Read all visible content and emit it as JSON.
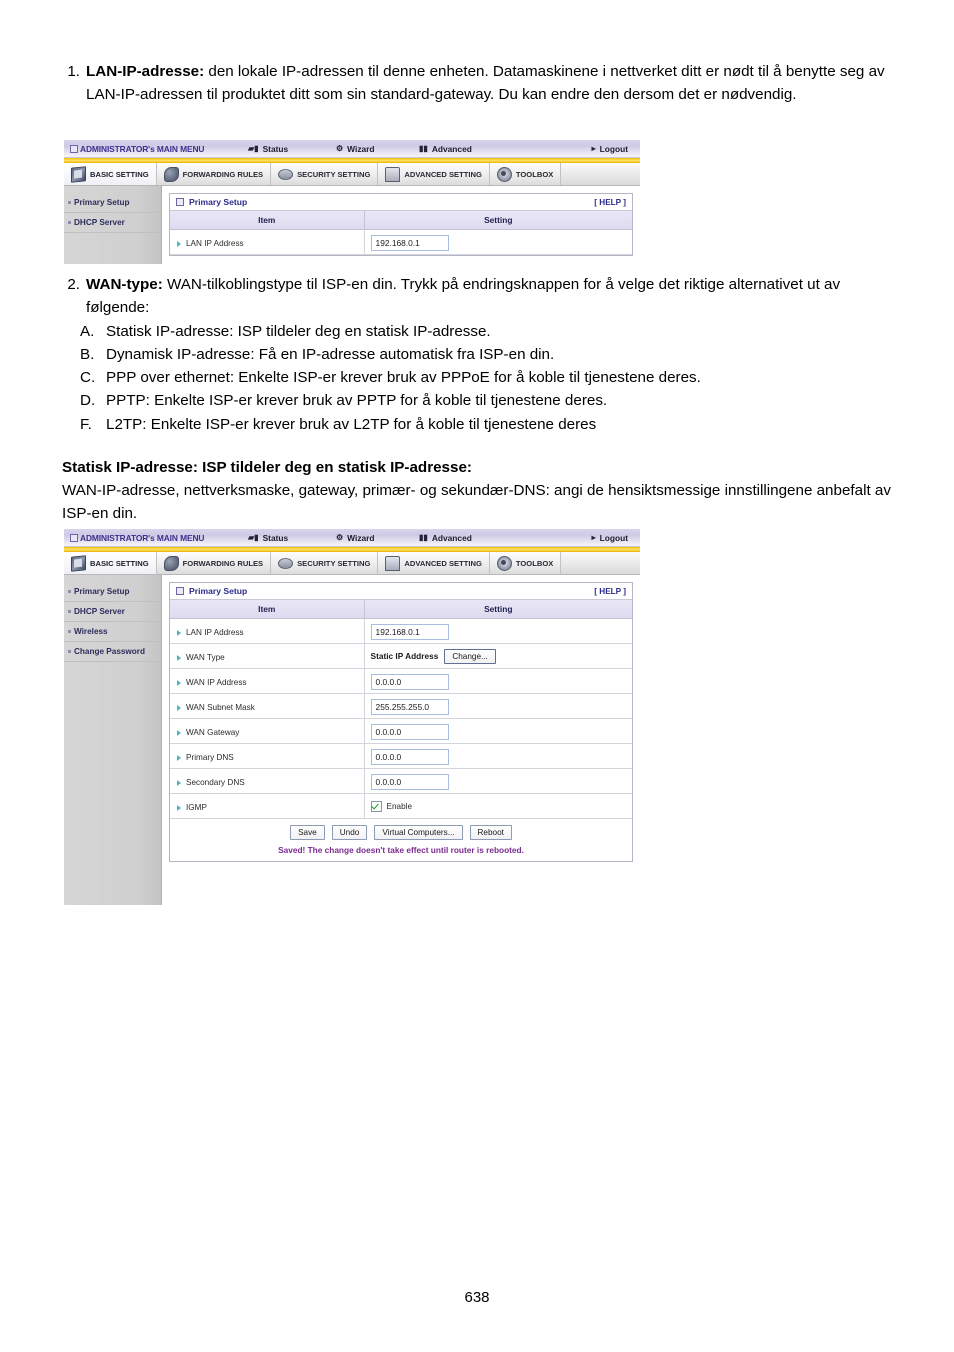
{
  "page": {
    "number": "638"
  },
  "content": {
    "item1": {
      "marker": "1.",
      "lead": "LAN-IP-adresse:",
      "text": " den lokale IP-adressen til denne enheten. Datamaskinene i nettverket ditt er nødt til å benytte seg av LAN-IP-adressen til produktet ditt som sin standard-gateway. Du kan endre den dersom det er nødvendig."
    },
    "item2": {
      "marker": "2.",
      "lead": "WAN-type:",
      "text": " WAN-tilkoblingstype til ISP-en din. Trykk på endringsknappen for å velge det riktige alternativet ut av følgende:",
      "options": [
        {
          "marker": "A.",
          "text": "Statisk IP-adresse: ISP tildeler deg en statisk IP-adresse."
        },
        {
          "marker": "B.",
          "text": "Dynamisk IP-adresse: Få en IP-adresse automatisk fra ISP-en din."
        },
        {
          "marker": "C.",
          "text": "PPP over ethernet: Enkelte ISP-er krever bruk av PPPoE for å koble til tjenestene deres."
        },
        {
          "marker": "D.",
          "text": "PPTP: Enkelte ISP-er krever bruk av PPTP for å koble til tjenestene deres."
        },
        {
          "marker": "F.",
          "text": "L2TP: Enkelte ISP-er krever bruk av L2TP for å koble til tjenestene deres"
        }
      ]
    },
    "section_static": {
      "heading": "Statisk IP-adresse: ISP tildeler deg en statisk IP-adresse:",
      "paragraph": "WAN-IP-adresse, nettverksmaske, gateway, primær- og sekundær-DNS: angi de hensiktsmessige innstillingene anbefalt av ISP-en din."
    }
  },
  "router_ui": {
    "topbar": {
      "brand": "ADMINISTRATOR's MAIN MENU",
      "status": "Status",
      "wizard": "Wizard",
      "advanced": "Advanced",
      "logout": "Logout",
      "logout_arrow": "▸"
    },
    "tabs": [
      {
        "label": "BASIC SETTING",
        "icon": "book-icon"
      },
      {
        "label": "FORWARDING RULES",
        "icon": "wrench-icon"
      },
      {
        "label": "SECURITY SETTING",
        "icon": "shield-icon"
      },
      {
        "label": "ADVANCED SETTING",
        "icon": "gate-icon"
      },
      {
        "label": "TOOLBOX",
        "icon": "tools-icon"
      }
    ],
    "sidebar_short": [
      {
        "label": "Primary Setup"
      },
      {
        "label": "DHCP Server"
      }
    ],
    "sidebar_full": [
      {
        "label": "Primary Setup"
      },
      {
        "label": "DHCP Server"
      },
      {
        "label": "Wireless"
      },
      {
        "label": "Change Password"
      }
    ],
    "panel": {
      "title": "Primary Setup",
      "help": "[ HELP ]",
      "col_item": "Item",
      "col_setting": "Setting"
    },
    "rows_short": [
      {
        "label": "LAN IP Address",
        "value": "192.168.0.1"
      }
    ],
    "rows_full": [
      {
        "label": "LAN IP Address",
        "value": "192.168.0.1",
        "kind": "input"
      },
      {
        "label": "WAN Type",
        "value": "Static IP Address",
        "button": "Change...",
        "kind": "wan-type"
      },
      {
        "label": "WAN IP Address",
        "value": "0.0.0.0",
        "kind": "input"
      },
      {
        "label": "WAN Subnet Mask",
        "value": "255.255.255.0",
        "kind": "input"
      },
      {
        "label": "WAN Gateway",
        "value": "0.0.0.0",
        "kind": "input"
      },
      {
        "label": "Primary DNS",
        "value": "0.0.0.0",
        "kind": "input"
      },
      {
        "label": "Secondary DNS",
        "value": "0.0.0.0",
        "kind": "input"
      },
      {
        "label": "IGMP",
        "value": "Enable",
        "kind": "checkbox",
        "checked": true
      }
    ],
    "footer": {
      "buttons": [
        "Save",
        "Undo",
        "Virtual Computers...",
        "Reboot"
      ],
      "status_message": "Saved! The change doesn't take effect until router is rebooted."
    }
  }
}
